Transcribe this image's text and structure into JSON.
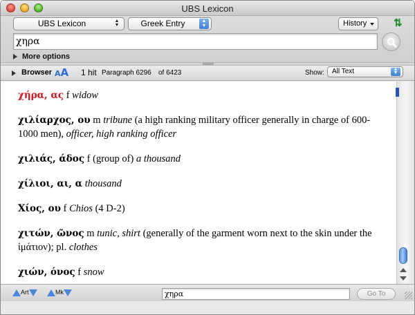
{
  "window": {
    "title": "UBS Lexicon"
  },
  "toolbar": {
    "resource_popup": "UBS Lexicon",
    "entry_type_popup": "Greek Entry",
    "history_label": "History",
    "search_value": "χηρα",
    "more_options_label": "More options"
  },
  "browser_bar": {
    "browser_label": "Browser",
    "font_size_small": "A",
    "font_size_large": "A",
    "hit_count": "1 hit",
    "paragraph": "Paragraph 6296",
    "paragraph_of": "of 6423",
    "show_label": "Show:",
    "show_value": "All Text"
  },
  "entries": [
    {
      "headword": "χήρα, ας",
      "highlight": true,
      "rest_html": "f <i>widow</i>"
    },
    {
      "headword": "χιλίαρχος, ου",
      "highlight": false,
      "rest_html": "m <i>tribune</i> (a high ranking military officer generally in charge of 600-1000 men), <i>officer, high ranking officer</i>"
    },
    {
      "headword": "χιλιάς, άδος",
      "highlight": false,
      "rest_html": "f (group of) <i>a thousand</i>"
    },
    {
      "headword": "χίλιοι, αι, α",
      "highlight": false,
      "rest_html": "<i>thousand</i>"
    },
    {
      "headword": "Χίος, ου",
      "highlight": false,
      "rest_html": "f <i>Chios</i> (4 D-2)"
    },
    {
      "headword": "χιτών, ῶνος",
      "highlight": false,
      "rest_html": "m <i>tunic, shirt</i> (generally of the garment worn next to the skin under the ἱμάτιον); pl. <i>clothes</i>"
    },
    {
      "headword": "χιών, όνος",
      "highlight": false,
      "rest_html": "f <i>snow</i>"
    }
  ],
  "status_bar": {
    "art_label": "Art",
    "mk_label": "Mk",
    "goto_value": "χηρα",
    "goto_button": "Go To"
  },
  "colors": {
    "headword_highlight": "#d2141b",
    "accent_blue": "#3d7fd6"
  }
}
